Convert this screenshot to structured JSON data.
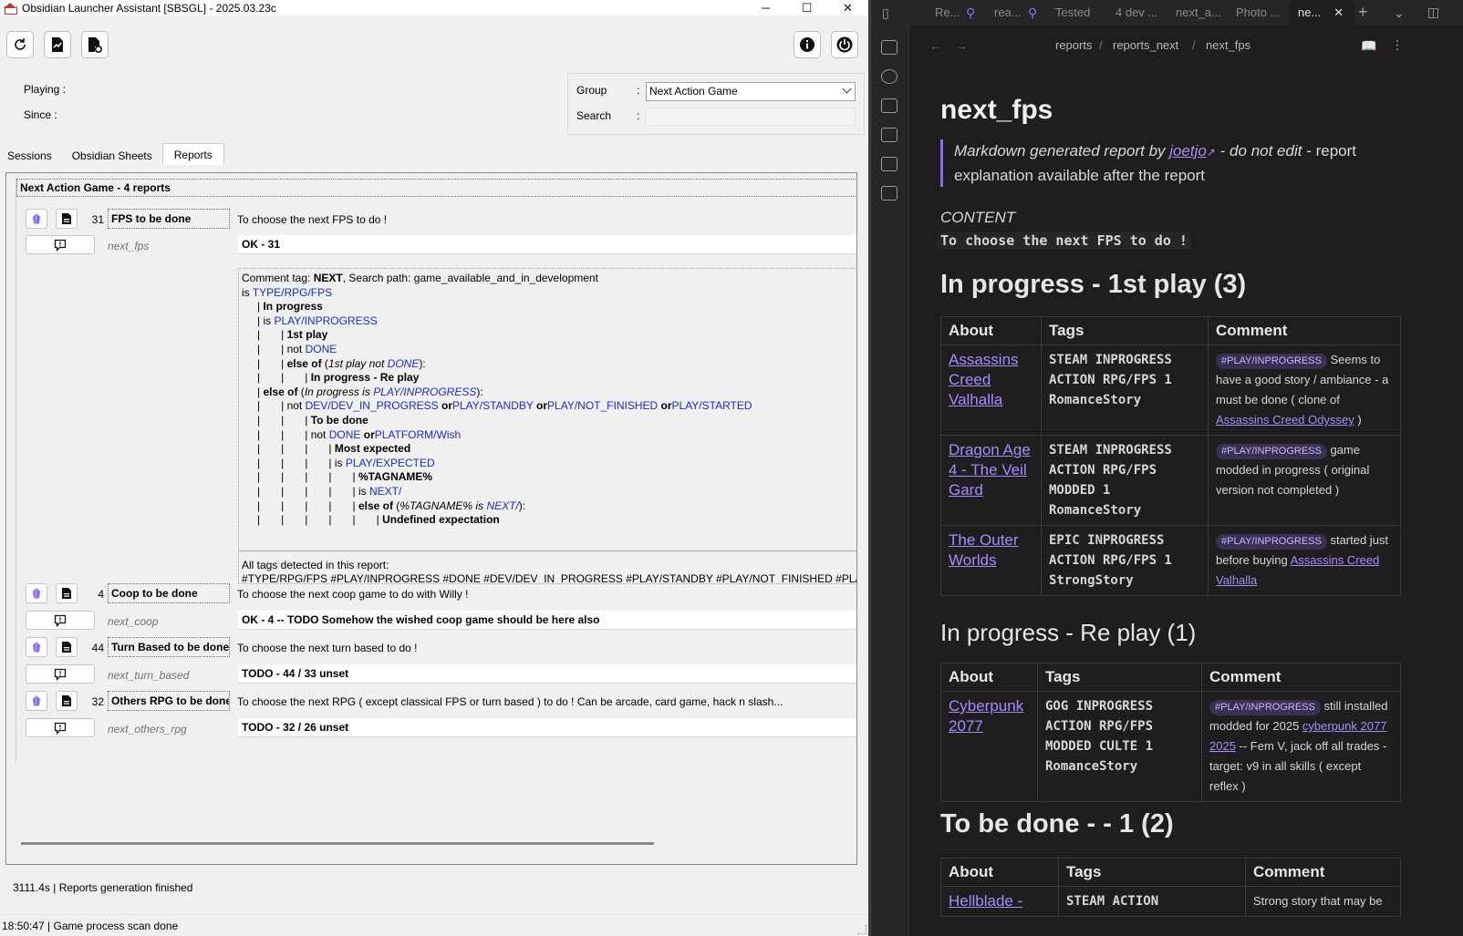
{
  "launcher": {
    "title": "Obsidian Launcher Assistant [SBSGL] - 2025.03.23c",
    "window_controls": {
      "minimize": "─",
      "maximize": "☐",
      "close": "✕"
    },
    "playing_label": "Playing :",
    "since_label": "Since    :",
    "group_label": "Group",
    "group_colon": ":",
    "group_value": "Next Action Game",
    "search_label": "Search",
    "search_colon": ":",
    "search_value": "",
    "tabs": [
      {
        "label": "Sessions"
      },
      {
        "label": "Obsidian Sheets"
      },
      {
        "label": "Reports"
      }
    ],
    "group_header": "Next Action Game - 4 reports",
    "reports": [
      {
        "num": "31",
        "name": "FPS to be done",
        "desc": "To choose the next FPS to do !",
        "file": "next_fps",
        "status": "OK - 31"
      },
      {
        "num": "4",
        "name": "Coop to be done",
        "desc": "To choose the next coop game to do with Willy !",
        "file": "next_coop",
        "status": "OK - 4 -- TODO Somehow the wished coop game should be here also"
      },
      {
        "num": "44",
        "name": "Turn Based to be done",
        "desc": "To choose the next turn based to do !",
        "file": "next_turn_based",
        "status": "TODO - 44 / 33 unset"
      },
      {
        "num": "32",
        "name": "Others RPG to be done",
        "desc": "To choose the next RPG ( except classical FPS or turn based ) to do ! Can be arcade, card game, hack n slash...",
        "file": "next_others_rpg",
        "status": "TODO - 32 / 26 unset"
      }
    ],
    "detail": {
      "comment_prefix": "Comment tag: ",
      "comment_tag": "NEXT",
      "search_path": ", Search path: game_available_and_in_development",
      "is_word": "is ",
      "type_tag": "TYPE/RPG/FPS",
      "in_progress": "In progress",
      "play_inprogress": "PLAY/INPROGRESS",
      "first_play": "1st play",
      "not_word": "not ",
      "done": "DONE",
      "else_of": "else of",
      "first_play_not": "1st play not ",
      "in_progress_replay": "In progress - Re play",
      "in_progress_is": "In progress is ",
      "dev_in_progress": "DEV/DEV_IN_PROGRESS",
      "or_word": "or",
      "play_standby": "PLAY/STANDBY",
      "play_not_finished": "PLAY/NOT_FINISHED",
      "play_started": "PLAY/STARTED",
      "to_be_done": "To be done",
      "platform_wish": "PLATFORM/Wish",
      "most_expected": "Most expected",
      "play_expected": "PLAY/EXPECTED",
      "tagname": "%TAGNAME%",
      "next_slash": "NEXT/",
      "tagname_is": "%TAGNAME% is ",
      "undefined_expectation": "Undefined expectation",
      "all_tags_label": "All tags detected in this report:",
      "all_tags": "#TYPE/RPG/FPS #PLAY/INPROGRESS #DONE #DEV/DEV_IN_PROGRESS #PLAY/STANDBY #PLAY/NOT_FINISHED #PLAY/STARTED #"
    },
    "status_line": "3111.4s | Reports generation finished",
    "bottom_line": "18:50:47 | Game process scan done"
  },
  "obsidian": {
    "tabs": [
      "Re...",
      "rea...",
      "Tested",
      "4 dev ...",
      "next_a...",
      "Photo ...",
      "ne..."
    ],
    "breadcrumb": [
      "reports",
      "/",
      "reports_next",
      "/",
      "next_fps"
    ],
    "title": "next_fps",
    "quote_part1": "Markdown generated report by ",
    "quote_link": "joetjo",
    "quote_part2": " - do not edit",
    "quote_part3": " - report explanation available after the report",
    "content_label": "CONTENT",
    "content_code": "To choose the next FPS to do !",
    "section1": "In progress - 1st play (3)",
    "section2": "In progress - Re play (1)",
    "section3": "To be done -  - 1 (2)",
    "table_headers": [
      "About",
      "Tags",
      "Comment"
    ],
    "rows1": [
      {
        "about": "Assassins Creed Valhalla",
        "tags": "STEAM INPROGRESS ACTION RPG/FPS 1 RomanceStory",
        "pill": "#PLAY/INPROGRESS",
        "comment": " Seems to have a good story / ambiance - a must be done ( clone of ",
        "link": "Assassins Creed Odyssey",
        "tail": " )"
      },
      {
        "about": "Dragon Age 4 - The Veil Gard",
        "tags": "STEAM INPROGRESS ACTION RPG/FPS MODDED 1 RomanceStory",
        "pill": "#PLAY/INPROGRESS",
        "comment": " game modded in progress ( original version not completed )",
        "link": "",
        "tail": ""
      },
      {
        "about": "The Outer Worlds",
        "tags": "EPIC INPROGRESS ACTION RPG/FPS 1 StrongStory",
        "pill": "#PLAY/INPROGRESS",
        "comment": " started just before buying ",
        "link": "Assassins Creed Valhalla",
        "tail": ""
      }
    ],
    "rows2": [
      {
        "about": "Cyberpunk 2077",
        "tags": "GOG INPROGRESS ACTION RPG/FPS MODDED CULTE 1 RomanceStory",
        "pill": "#PLAY/INPROGRESS",
        "comment": " still installed modded for 2025 ",
        "link": "cyberpunk 2077 2025",
        "tail": " -- Fem V, jack off all trades - target: v9 in all skills ( except reflex )"
      }
    ],
    "rows3": [
      {
        "about": "Hellblade -",
        "tags": "STEAM ACTION",
        "comment": "Strong story that may be"
      }
    ]
  }
}
